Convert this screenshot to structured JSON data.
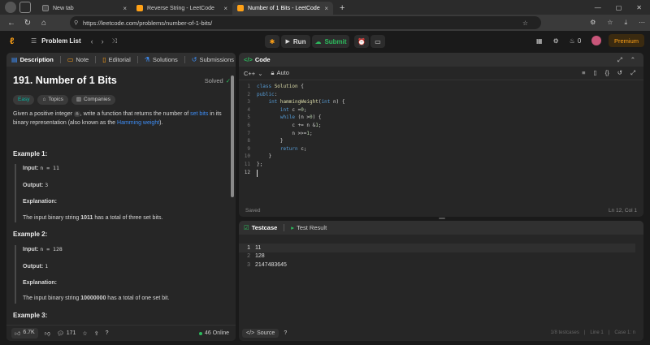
{
  "browser": {
    "tabs": [
      {
        "title": "New tab",
        "favicon_color": "#4a4a4a"
      },
      {
        "title": "Reverse String - LeetCode",
        "favicon_color": "#ffa116"
      },
      {
        "title": "Number of 1 Bits - LeetCode",
        "favicon_color": "#ffa116"
      }
    ],
    "url": "https://leetcode.com/problems/number-of-1-bits/"
  },
  "topbar": {
    "problem_list": "Problem List",
    "run": "Run",
    "submit": "Submit",
    "streak": "0",
    "premium": "Premium"
  },
  "description": {
    "tabs": [
      "Description",
      "Note",
      "Editorial",
      "Solutions",
      "Submissions"
    ],
    "title": "191. Number of 1 Bits",
    "status": "Solved",
    "difficulty": "Easy",
    "tags": [
      "Topics",
      "Companies"
    ],
    "intro_1": "Given a positive integer ",
    "intro_var": "n",
    "intro_2": ", write a function that returns the number of ",
    "intro_link1": "set bits",
    "intro_3": " in its binary representation (also known as the ",
    "intro_link2": "Hamming weight",
    "intro_4": ").",
    "examples": [
      {
        "title": "Example 1:",
        "input_label": "Input:",
        "input": "n = 11",
        "output_label": "Output:",
        "output": "3",
        "expl_label": "Explanation:",
        "expl_1": "The input binary string ",
        "expl_bold": "1011",
        "expl_2": " has a total of three set bits."
      },
      {
        "title": "Example 2:",
        "input_label": "Input:",
        "input": "n = 128",
        "output_label": "Output:",
        "output": "1",
        "expl_label": "Explanation:",
        "expl_1": "The input binary string ",
        "expl_bold": "10000000",
        "expl_2": " has a total of one set bit."
      }
    ],
    "example3_title": "Example 3:",
    "likes": "6.7K",
    "comments": "171",
    "online": "46 Online"
  },
  "code": {
    "tab": "Code",
    "language": "C++",
    "autosave": "Auto",
    "lines": [
      "class Solution {",
      "public:",
      "    int hammingWeight(int n) {",
      "        int c = 0;",
      "        while (n > 0) {",
      "            c += n & 1;",
      "            n >>= 1;",
      "        }",
      "        return c;",
      "    }",
      "};",
      ""
    ],
    "status": "Saved",
    "cursor": "Ln 12, Col 1"
  },
  "testcase": {
    "tab1": "Testcase",
    "tab2": "Test Result",
    "lines": [
      "11",
      "128",
      "2147483645"
    ],
    "source": "Source",
    "footer": [
      "1/8 testcases",
      "Line 1",
      "Case 1: n"
    ]
  },
  "colors": {
    "accent": "#ffa116",
    "success": "#2cbb5d",
    "link": "#3e8ef7"
  }
}
